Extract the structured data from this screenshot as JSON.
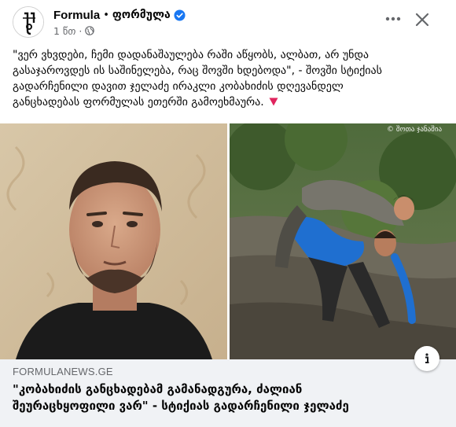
{
  "post": {
    "page_name": "Formula",
    "separator": "•",
    "page_name_alt": "ფორმულა",
    "time": "1 წთ",
    "meta_dot": "·",
    "privacy_icon": "globe-icon",
    "text_lines": [
      "\"ვერ ვხვდები, ჩემი დადანაშაულება რაში აწყობს, ალბათ, არ უნდა",
      "გასაჯაროვდეს ის საშინელება, რაც შოვში ხდებოდა\", - შოვში სტიქიას",
      "გადარჩენილი დავით ჯელაძე ირაკლი კობახიძის დღევანდელ",
      "განცხადებას ფორმულას ეთერში გამოეხმაურა."
    ],
    "alert_icon": "red-triangle-down-icon"
  },
  "media": {
    "watermark": "© შოთა ჯანაშია"
  },
  "link": {
    "domain": "FORMULANEWS.GE",
    "title_lines": [
      "\"კობახიძის განცხადებამ გამანადგურა, ძალიან",
      "შეურაცხყოფილი ვარ\" - სტიქიას გადარჩენილი ჯელაძე"
    ]
  },
  "colors": {
    "verified": "#1877f2",
    "secondary_text": "#65676b",
    "preview_bg": "#f0f2f5",
    "alert": "#e0245e"
  }
}
